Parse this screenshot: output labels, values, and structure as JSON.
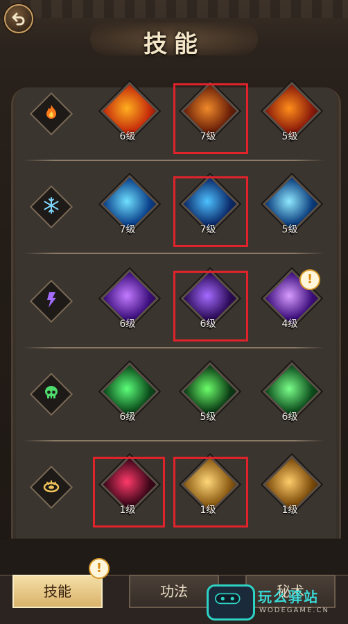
{
  "header": {
    "title": "技能"
  },
  "rows": [
    {
      "element": "fire-icon",
      "skills": [
        {
          "name": "fire-skill-1",
          "level": "6级",
          "colors": [
            "#ffb020",
            "#c42a0a"
          ]
        },
        {
          "name": "fire-skill-2",
          "level": "7级",
          "colors": [
            "#f08a2a",
            "#6a1f08"
          ],
          "highlighted": true
        },
        {
          "name": "fire-skill-3",
          "level": "5级",
          "colors": [
            "#ff8e1a",
            "#8a1a0a"
          ]
        }
      ]
    },
    {
      "element": "snowflake-icon",
      "skills": [
        {
          "name": "ice-skill-1",
          "level": "7级",
          "colors": [
            "#6fe0ff",
            "#0a3f8a"
          ]
        },
        {
          "name": "ice-skill-2",
          "level": "7级",
          "colors": [
            "#4ec1ff",
            "#0b2a6a"
          ],
          "highlighted": true
        },
        {
          "name": "ice-skill-3",
          "level": "5级",
          "colors": [
            "#8fe8ff",
            "#0a3c7c"
          ]
        }
      ]
    },
    {
      "element": "lightning-icon",
      "skills": [
        {
          "name": "thunder-skill-1",
          "level": "6级",
          "colors": [
            "#c27bff",
            "#3a0d7a"
          ]
        },
        {
          "name": "thunder-skill-2",
          "level": "6级",
          "colors": [
            "#a46bff",
            "#2a0a55"
          ],
          "highlighted": true
        },
        {
          "name": "thunder-skill-3",
          "level": "4级",
          "colors": [
            "#d79cff",
            "#3b0d7a"
          ],
          "badge": "!"
        }
      ]
    },
    {
      "element": "skull-icon",
      "skills": [
        {
          "name": "poison-skill-1",
          "level": "6级",
          "colors": [
            "#5cff7a",
            "#0a4a1a"
          ]
        },
        {
          "name": "poison-skill-2",
          "level": "5级",
          "colors": [
            "#6cff6a",
            "#0a3a14"
          ]
        },
        {
          "name": "poison-skill-3",
          "level": "6级",
          "colors": [
            "#7bff8a",
            "#0b4c1b"
          ]
        }
      ]
    },
    {
      "element": "light-ring-icon",
      "skills": [
        {
          "name": "dark-skill",
          "level": "1级",
          "colors": [
            "#ff3a6a",
            "#3a0618"
          ],
          "highlighted": true
        },
        {
          "name": "light-skill-1",
          "level": "1级",
          "colors": [
            "#ffd77a",
            "#8a5a12"
          ],
          "highlighted": true
        },
        {
          "name": "light-skill-2",
          "level": "1级",
          "colors": [
            "#ffcc6a",
            "#7a4a0a"
          ]
        }
      ]
    }
  ],
  "tabs": [
    {
      "label": "技能",
      "active": true,
      "badge": "!"
    },
    {
      "label": "功法",
      "active": false
    },
    {
      "label": "秘术",
      "active": false
    }
  ],
  "watermark": {
    "text": "玩么驿站",
    "sub": "WODEGAME.CN"
  },
  "colors": {
    "highlight": "#e0232b",
    "panel": "#3b3530"
  }
}
